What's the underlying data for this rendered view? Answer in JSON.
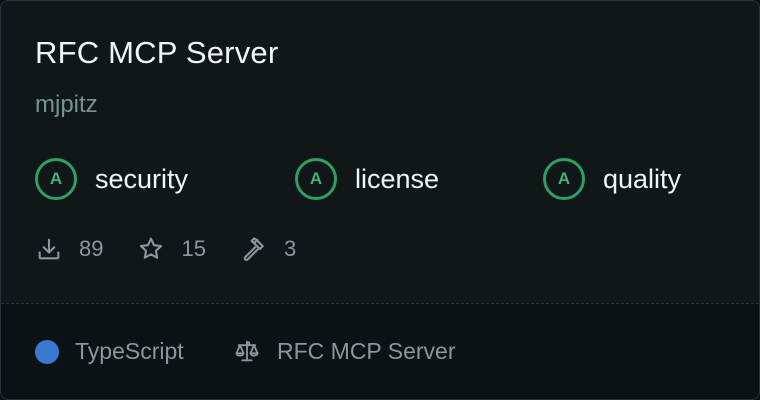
{
  "server": {
    "title": "RFC MCP Server",
    "author": "mjpitz"
  },
  "grades": [
    {
      "grade": "A",
      "label": "security"
    },
    {
      "grade": "A",
      "label": "license"
    },
    {
      "grade": "A",
      "label": "quality"
    }
  ],
  "stats": {
    "downloads": "89",
    "stars": "15",
    "tools": "3"
  },
  "footer": {
    "language": "TypeScript",
    "language_color": "#3a7bd0",
    "license_name": "RFC MCP Server"
  },
  "icons": {
    "downloads": "download-icon",
    "stars": "star-icon",
    "tools": "hammer-icon",
    "license": "scale-icon"
  },
  "colors": {
    "grade_accent": "#2f9e62",
    "author": "#73968b"
  }
}
